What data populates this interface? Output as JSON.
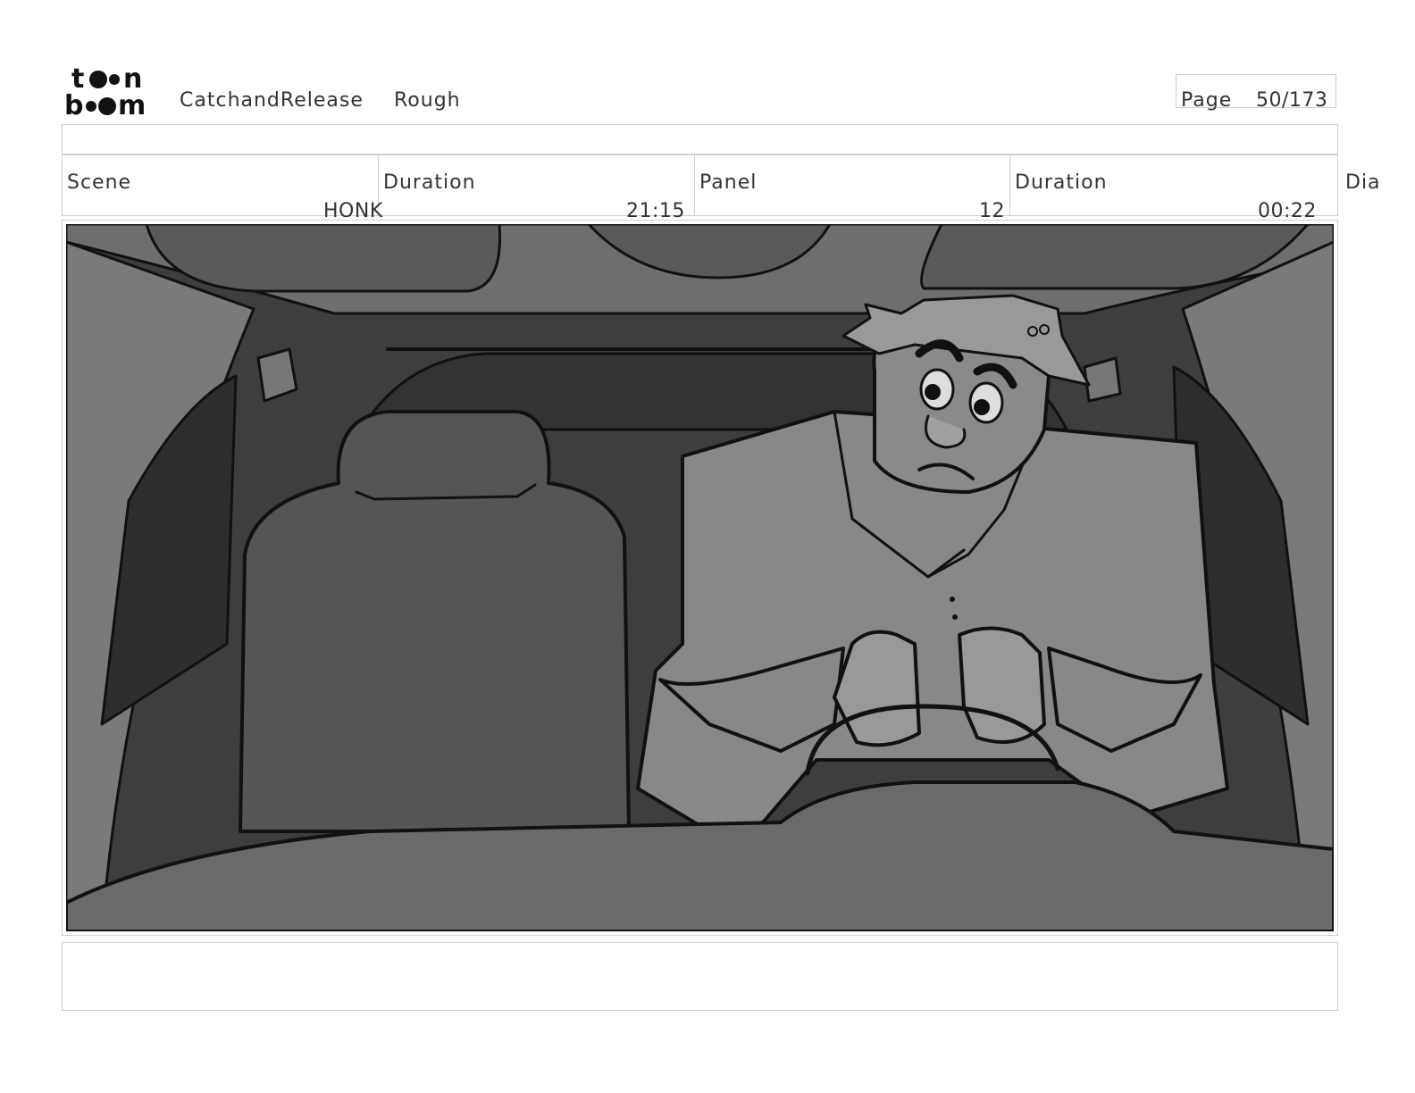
{
  "header": {
    "logo_top": "t",
    "logo_top_end": "n",
    "logo_bottom_start": "b",
    "logo_bottom_end": "m",
    "project": "CatchandRelease",
    "version": "Rough",
    "page_label": "Page",
    "page_number": "50/173"
  },
  "info": {
    "scene_label": "Scene",
    "scene_value": "HONK",
    "scene_duration_label": "Duration",
    "scene_duration_value": "21:15",
    "panel_label": "Panel",
    "panel_value": "12",
    "panel_duration_label": "Duration",
    "panel_duration_value": "00:22",
    "dialogue_label": "Dia"
  },
  "colors": {
    "border": "#cfcfcf",
    "text": "#333333",
    "ink": "#111111",
    "skin": "#8a8a8a",
    "shirt": "#888888",
    "seat": "#555555",
    "interior_dark": "#3e3e3e"
  }
}
